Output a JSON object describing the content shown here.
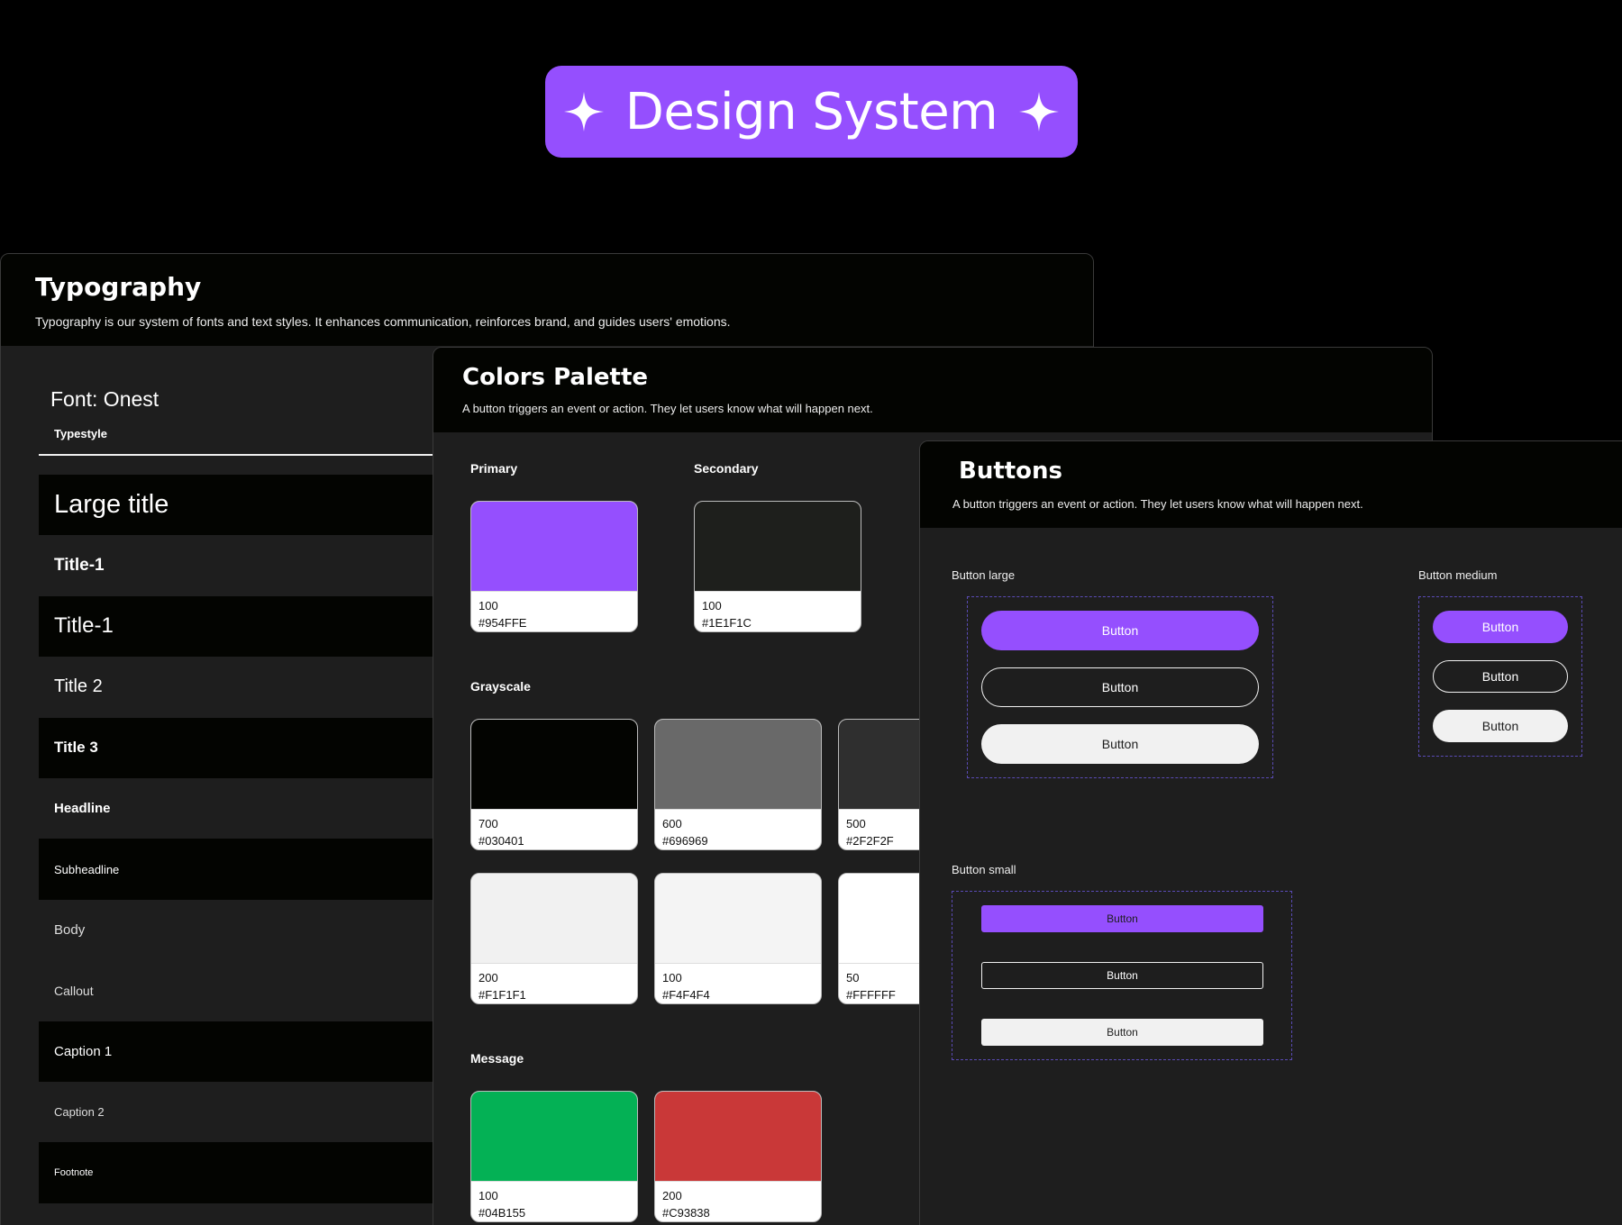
{
  "hero": {
    "title": "Design System",
    "icon": "sparkle-icon"
  },
  "typography": {
    "title": "Typography",
    "description": "Typography is our system of fonts and text styles. It enhances communication, reinforces brand, and guides users' emotions.",
    "font_name": "Font: Onest",
    "column_header": "Typestyle",
    "styles": [
      "Large title",
      "Title-1",
      "Title-1",
      "Title 2",
      "Title 3",
      "Headline",
      "Subheadline",
      "Body",
      "Callout",
      "Caption 1",
      "Caption 2",
      "Footnote"
    ]
  },
  "colors": {
    "title": "Colors Palette",
    "description": "A button triggers an event or action. They let users know what will happen next.",
    "groups": {
      "primary": "Primary",
      "secondary": "Secondary",
      "grayscale": "Grayscale",
      "message": "Message"
    },
    "swatches": {
      "primary_100": {
        "weight": "100",
        "hex": "#954FFE"
      },
      "secondary_100": {
        "weight": "100",
        "hex": "#1E1F1C"
      },
      "gray_700": {
        "weight": "700",
        "hex": "#030401"
      },
      "gray_600": {
        "weight": "600",
        "hex": "#696969"
      },
      "gray_500": {
        "weight": "500",
        "hex": "#2F2F2F"
      },
      "gray_200": {
        "weight": "200",
        "hex": "#F1F1F1"
      },
      "gray_100": {
        "weight": "100",
        "hex": "#F4F4F4"
      },
      "gray_50": {
        "weight": "50",
        "hex": "#FFFFFF"
      },
      "message_100": {
        "weight": "100",
        "hex": "#04B155"
      },
      "message_200": {
        "weight": "200",
        "hex": "#C93838"
      }
    }
  },
  "buttons": {
    "title": "Buttons",
    "description": "A button triggers an event or action. They let users know what will happen next.",
    "large_label": "Button large",
    "medium_label": "Button medium",
    "small_label": "Button small",
    "button_text": "Button"
  },
  "theme": {
    "accent": "#954FFE",
    "surface": "#1E1E1E",
    "background": "#000000"
  }
}
